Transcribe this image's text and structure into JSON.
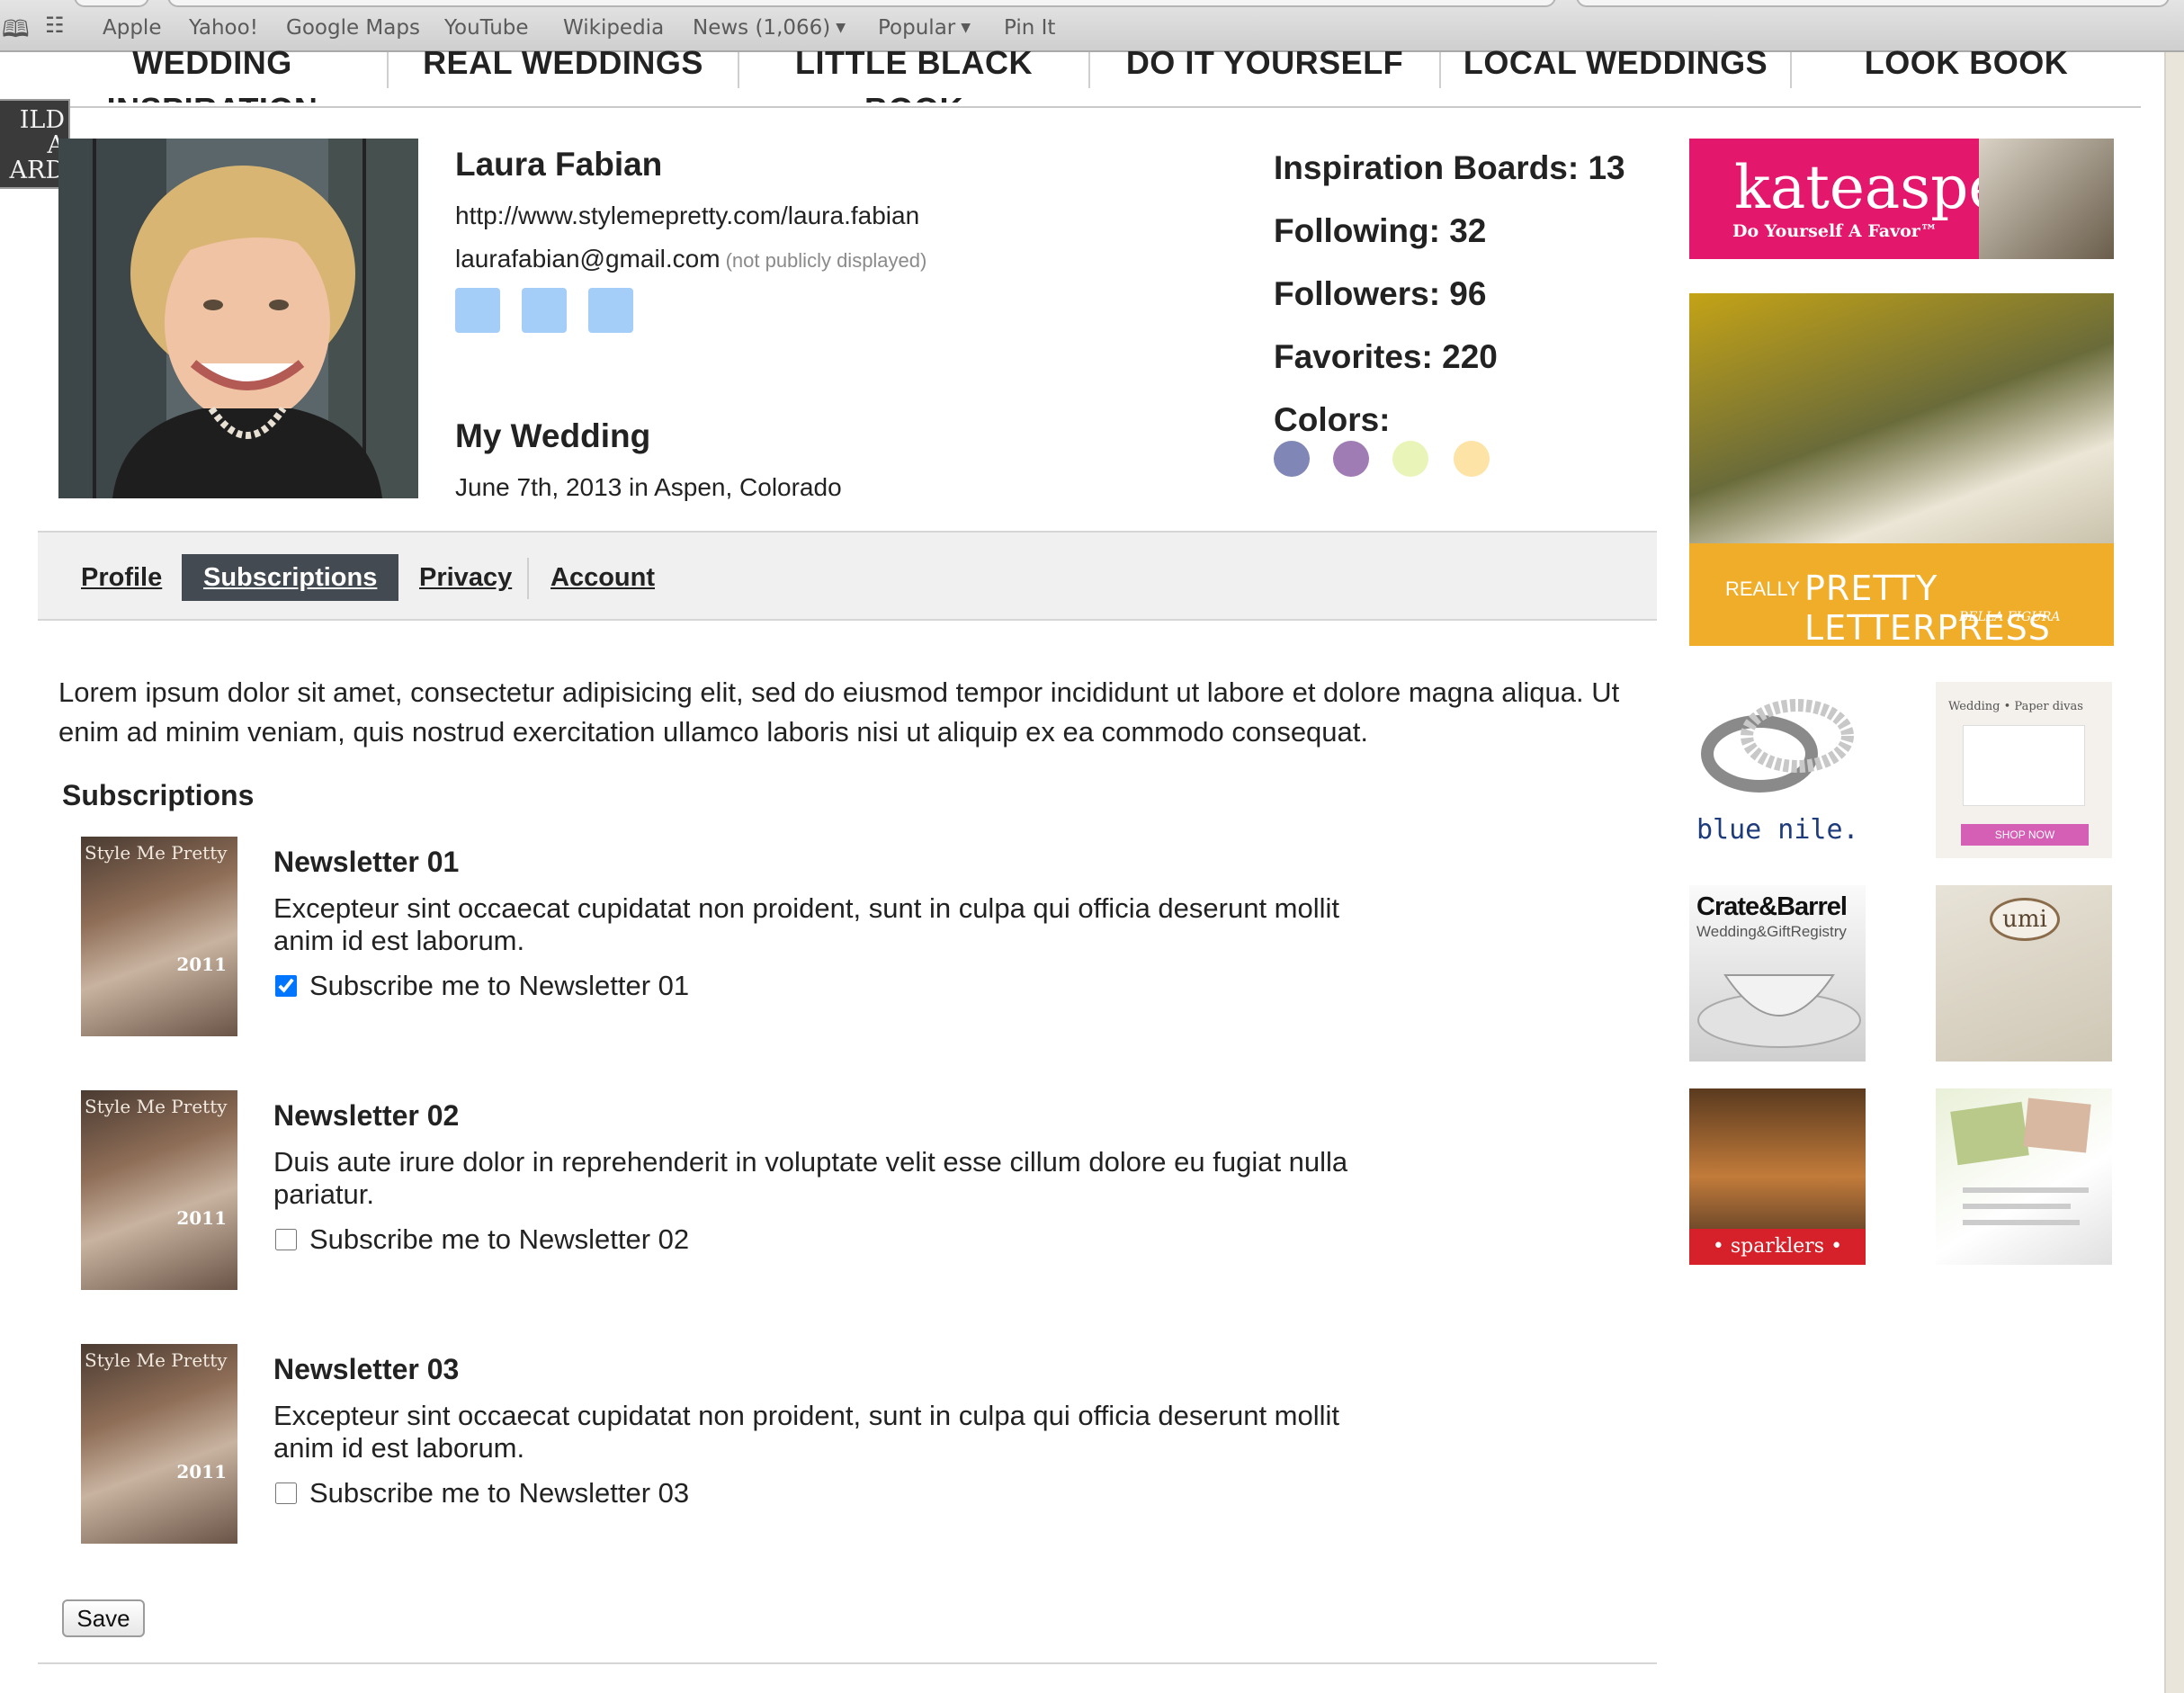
{
  "bookmarks": {
    "items": [
      "Apple",
      "Yahoo!",
      "Google Maps",
      "YouTube",
      "Wikipedia",
      "News (1,066)",
      "Popular",
      "Pin It"
    ]
  },
  "topnav": {
    "items": [
      "Wedding Inspiration",
      "Real Weddings",
      "Little Black Book",
      "Do It Yourself",
      "Local Weddings",
      "Look Book"
    ]
  },
  "side_tab": {
    "label": "ILD\nA\nARD"
  },
  "profile": {
    "name": "Laura Fabian",
    "url": "http://www.stylemepretty.com/laura.fabian",
    "email": "laurafabian@gmail.com",
    "email_note": "(not publicly displayed)",
    "wedding_title": "My Wedding",
    "wedding_info": "June 7th, 2013 in Aspen, Colorado"
  },
  "stats": {
    "inspiration_boards": "Inspiration Boards: 13",
    "following": "Following: 32",
    "followers": "Followers: 96",
    "favorites": "Favorites: 220",
    "colors_label": "Colors:"
  },
  "colors": [
    "#8086b5",
    "#a07cb5",
    "#e9f5b8",
    "#fde3a6"
  ],
  "tabs": [
    {
      "label": "Profile",
      "active": false
    },
    {
      "label": "Subscriptions",
      "active": true
    },
    {
      "label": "Privacy",
      "active": false
    },
    {
      "label": "Account",
      "active": false
    }
  ],
  "intro": "Lorem ipsum dolor sit amet, consectetur adipisicing elit, sed do eiusmod tempor incididunt ut labore et dolore magna aliqua. Ut enim ad minim veniam, quis nostrud exercitation ullamco laboris nisi ut aliquip ex ea commodo consequat.",
  "subscriptions": {
    "heading": "Subscriptions",
    "cover_title": "Style Me Pretty",
    "cover_year": "2011",
    "newsletters": [
      {
        "title": "Newsletter 01",
        "description": "Excepteur sint occaecat cupidatat non proident, sunt in culpa qui officia deserunt mollit anim id est laborum.",
        "checkbox_label": "Subscribe me to Newsletter 01",
        "checked": true
      },
      {
        "title": "Newsletter 02",
        "description": "Duis aute irure dolor in reprehenderit in voluptate velit esse cillum dolore eu fugiat nulla pariatur.",
        "checkbox_label": "Subscribe me to Newsletter 02",
        "checked": false
      },
      {
        "title": "Newsletter 03",
        "description": "Excepteur sint occaecat cupidatat non proident, sunt in culpa qui officia deserunt mollit anim id est laborum.",
        "checkbox_label": "Subscribe me to Newsletter 03",
        "checked": false
      }
    ]
  },
  "save_label": "Save",
  "ads": {
    "kate_logo": "kateaspen",
    "kate_tagline": "Do Yourself A Favor™",
    "letterpress_really": "REALLY",
    "letterpress_text": "PRETTY LETTERPRESS",
    "letterpress_sub": "BELLA FIGURA",
    "bluenile": "blue nile.",
    "wpd_title": "Wedding • Paper divas",
    "wpd_shop": "SHOP NOW",
    "crate_name": "Crate&Barrel",
    "crate_sub": "Wedding&GiftRegistry",
    "umi": "umi",
    "sparklers": "• sparklers •"
  }
}
